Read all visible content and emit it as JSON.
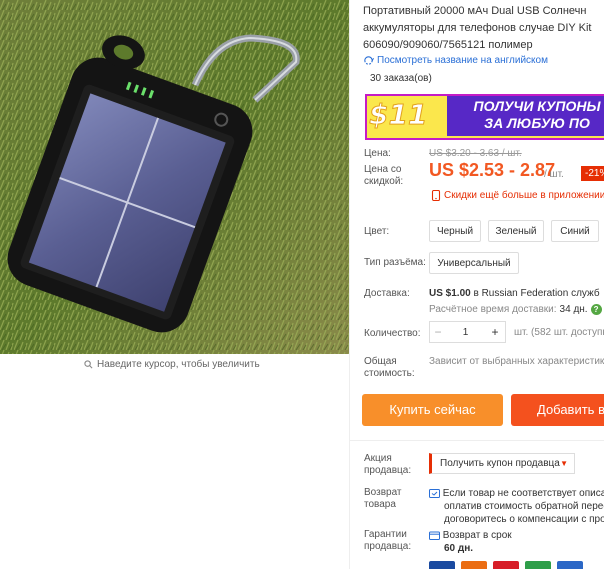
{
  "product": {
    "title_lines": [
      "Портативный 20000 мАч Dual USB Солнечн",
      "аккумуляторы для телефонов случае DIY Kit",
      "606090/909060/7565121 полимер"
    ],
    "translate_link": "Посмотреть название на английском",
    "orders": "30 заказа(ов)"
  },
  "banner": {
    "price": "$11",
    "line1": "ПОЛУЧИ КУПОНЫ",
    "line2": "ЗА ЛЮБУЮ ПО"
  },
  "image": {
    "zoom_hint": "Наведите курсор, чтобы увеличить"
  },
  "price": {
    "label": "Цена:",
    "old": "US $3.20 - 3.63 / шт.",
    "discount_label_1": "Цена со",
    "discount_label_2": "скидкой:",
    "new": "US $2.53 - 2.87",
    "unit": "/ шт.",
    "discount": "-21%",
    "app_promo": "Скидки ещё больше в приложении"
  },
  "color": {
    "label": "Цвет:",
    "options": [
      "Черный",
      "Зеленый",
      "Синий"
    ]
  },
  "connector": {
    "label": "Тип разъёма:",
    "options": [
      "Универсальный"
    ]
  },
  "shipping": {
    "label": "Доставка:",
    "value_bold": "US $1.00",
    "value_rest": " в Russian Federation служб",
    "time_label": "Расчётное время доставки:",
    "time_value": "34 дн.",
    "help": "?"
  },
  "quantity": {
    "label": "Количество:",
    "value": "1",
    "minus": "−",
    "plus": "+",
    "note": "шт. (582 шт. доступн"
  },
  "total": {
    "label_1": "Общая",
    "label_2": "стоимость:",
    "note": "Зависит от выбранных характеристик"
  },
  "buttons": {
    "buy": "Купить сейчас",
    "cart": "Добавить в"
  },
  "promo": {
    "label_1": "Акция",
    "label_2": "продавца:",
    "select": "Получить купон продавца",
    "caret": "▼"
  },
  "returns": {
    "label_1": "Возврат",
    "label_2": "товара",
    "lines": [
      "Если товар не соответствует описан",
      "оплатив стоимость обратной перес",
      "договоритесь о компенсации с про"
    ]
  },
  "warranty": {
    "label_1": "Гарантии",
    "label_2": "продавца:",
    "line1": "Возврат в срок",
    "line2": "60 дн."
  },
  "colors": {
    "accent": "#f25822",
    "link": "#2a6fd6",
    "buy": "#f88f2a",
    "cart": "#f4511e",
    "discount": "#e62e04"
  }
}
